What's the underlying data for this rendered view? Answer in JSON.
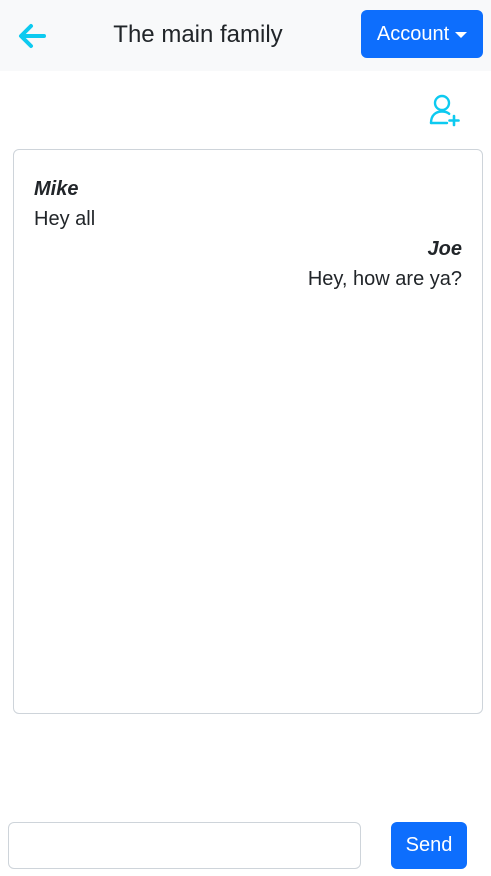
{
  "header": {
    "back_icon": "arrow-left-icon",
    "title": "The main family",
    "account_label": "Account",
    "account_caret_icon": "caret-down-icon"
  },
  "toolbar": {
    "add_user_icon": "person-plus-icon"
  },
  "chat": {
    "messages": [
      {
        "sender": "Mike",
        "text": "Hey all",
        "align": "left"
      },
      {
        "sender": "Joe",
        "text": "Hey, how are ya?",
        "align": "right"
      }
    ]
  },
  "composer": {
    "input_value": "",
    "input_placeholder": "",
    "send_label": "Send"
  },
  "colors": {
    "primary": "#0d6efd",
    "icon_accent": "#0dcaf0",
    "header_bg": "#f8f9fa",
    "border": "#ced4da"
  }
}
